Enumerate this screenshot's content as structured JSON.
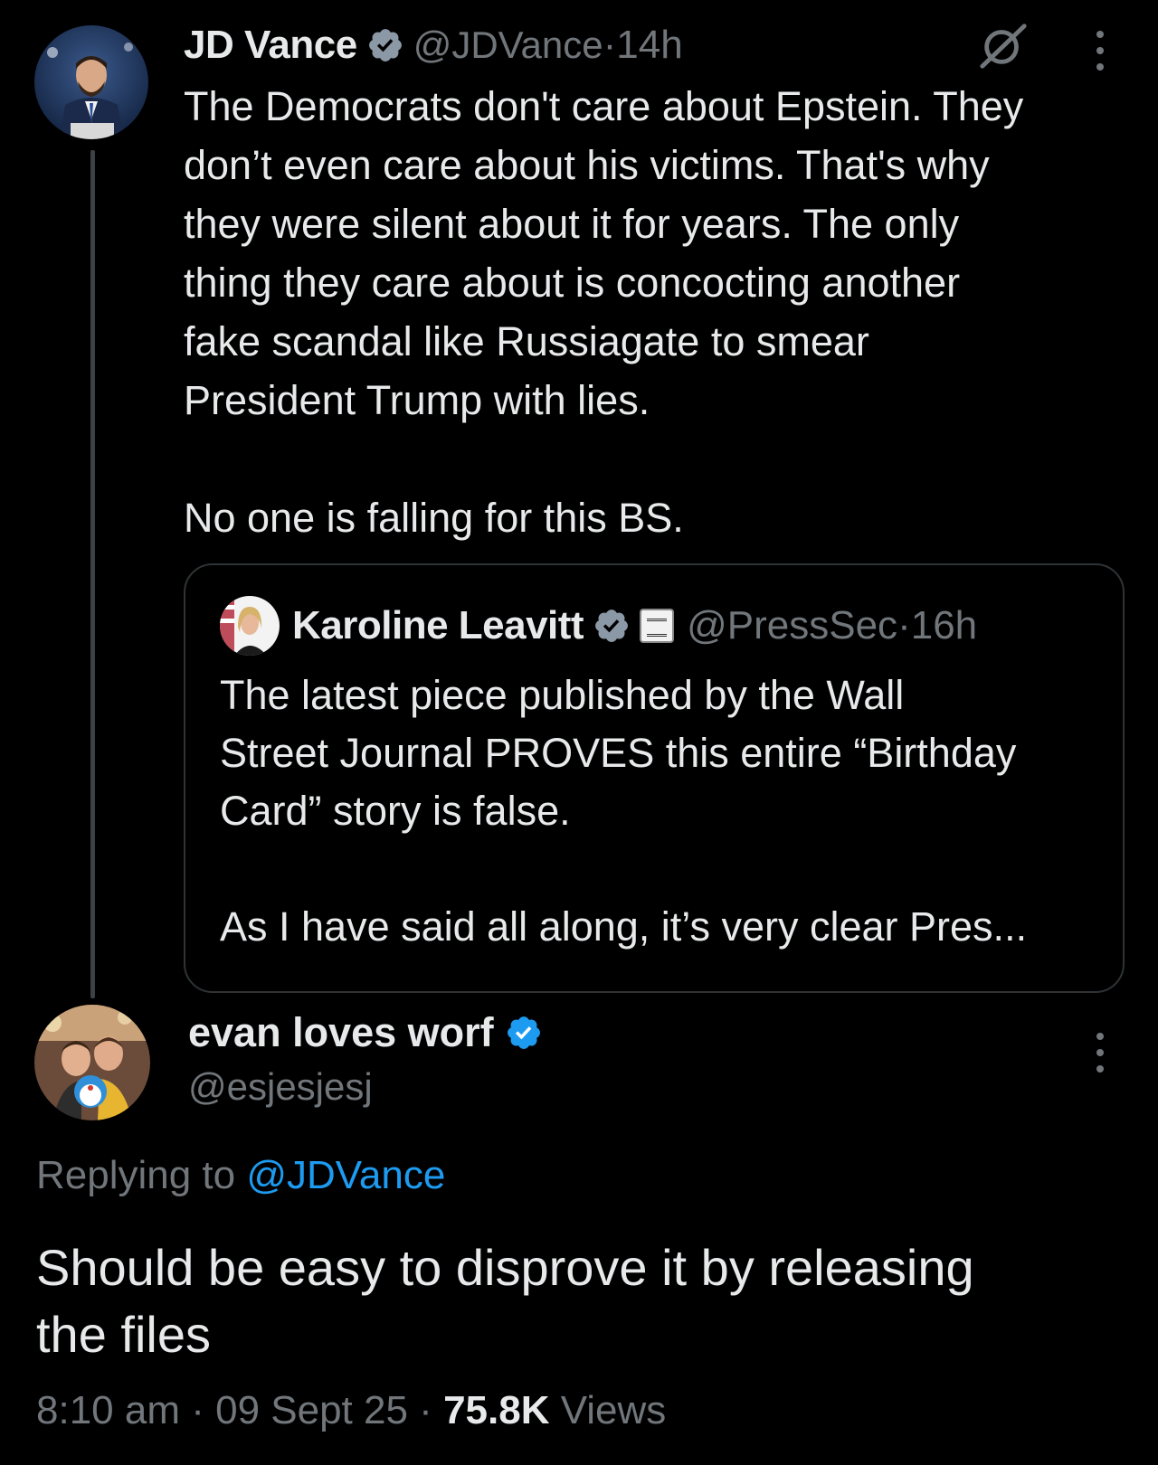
{
  "parent_post": {
    "display_name": "JD Vance",
    "handle": "@JDVance",
    "separator": " · ",
    "time": "14h",
    "lines": [
      "The Democrats don't care about Epstein. They",
      "don’t even care about his victims. That's why",
      "they were silent about it for years. The only",
      "thing they care about is concocting another",
      "fake scandal like Russiagate to smear",
      "President Trump with lies."
    ],
    "line_final": "No one is falling for this BS."
  },
  "quoted_post": {
    "display_name": "Karoline Leavitt",
    "handle": "@PressSec",
    "separator": " · ",
    "time": "16h",
    "lines": [
      "The latest piece published by the Wall",
      "Street Journal PROVES this entire “Birthday",
      "Card” story is false."
    ],
    "line_final": "As I have said all along, it’s very clear Pres..."
  },
  "reply_post": {
    "display_name": "evan loves worf",
    "handle": "@esjesjesj",
    "replying_prefix": "Replying to ",
    "replying_to": "@JDVance",
    "lines": [
      "Should be easy to disprove it by releasing",
      "the files"
    ],
    "time": "8:10 am",
    "separator": " · ",
    "date": "09 Sept 25",
    "views_count": "75.8K",
    "views_label": " Views"
  },
  "icons": {
    "verified": "verified-badge-icon",
    "grok": "grok-icon",
    "more": "more-options-icon",
    "affiliation": "white-house-badge-icon"
  },
  "colors": {
    "background": "#000000",
    "text": "#e7e9ea",
    "muted": "#71767b",
    "accent": "#1d9bf0",
    "border": "#2f3336"
  }
}
